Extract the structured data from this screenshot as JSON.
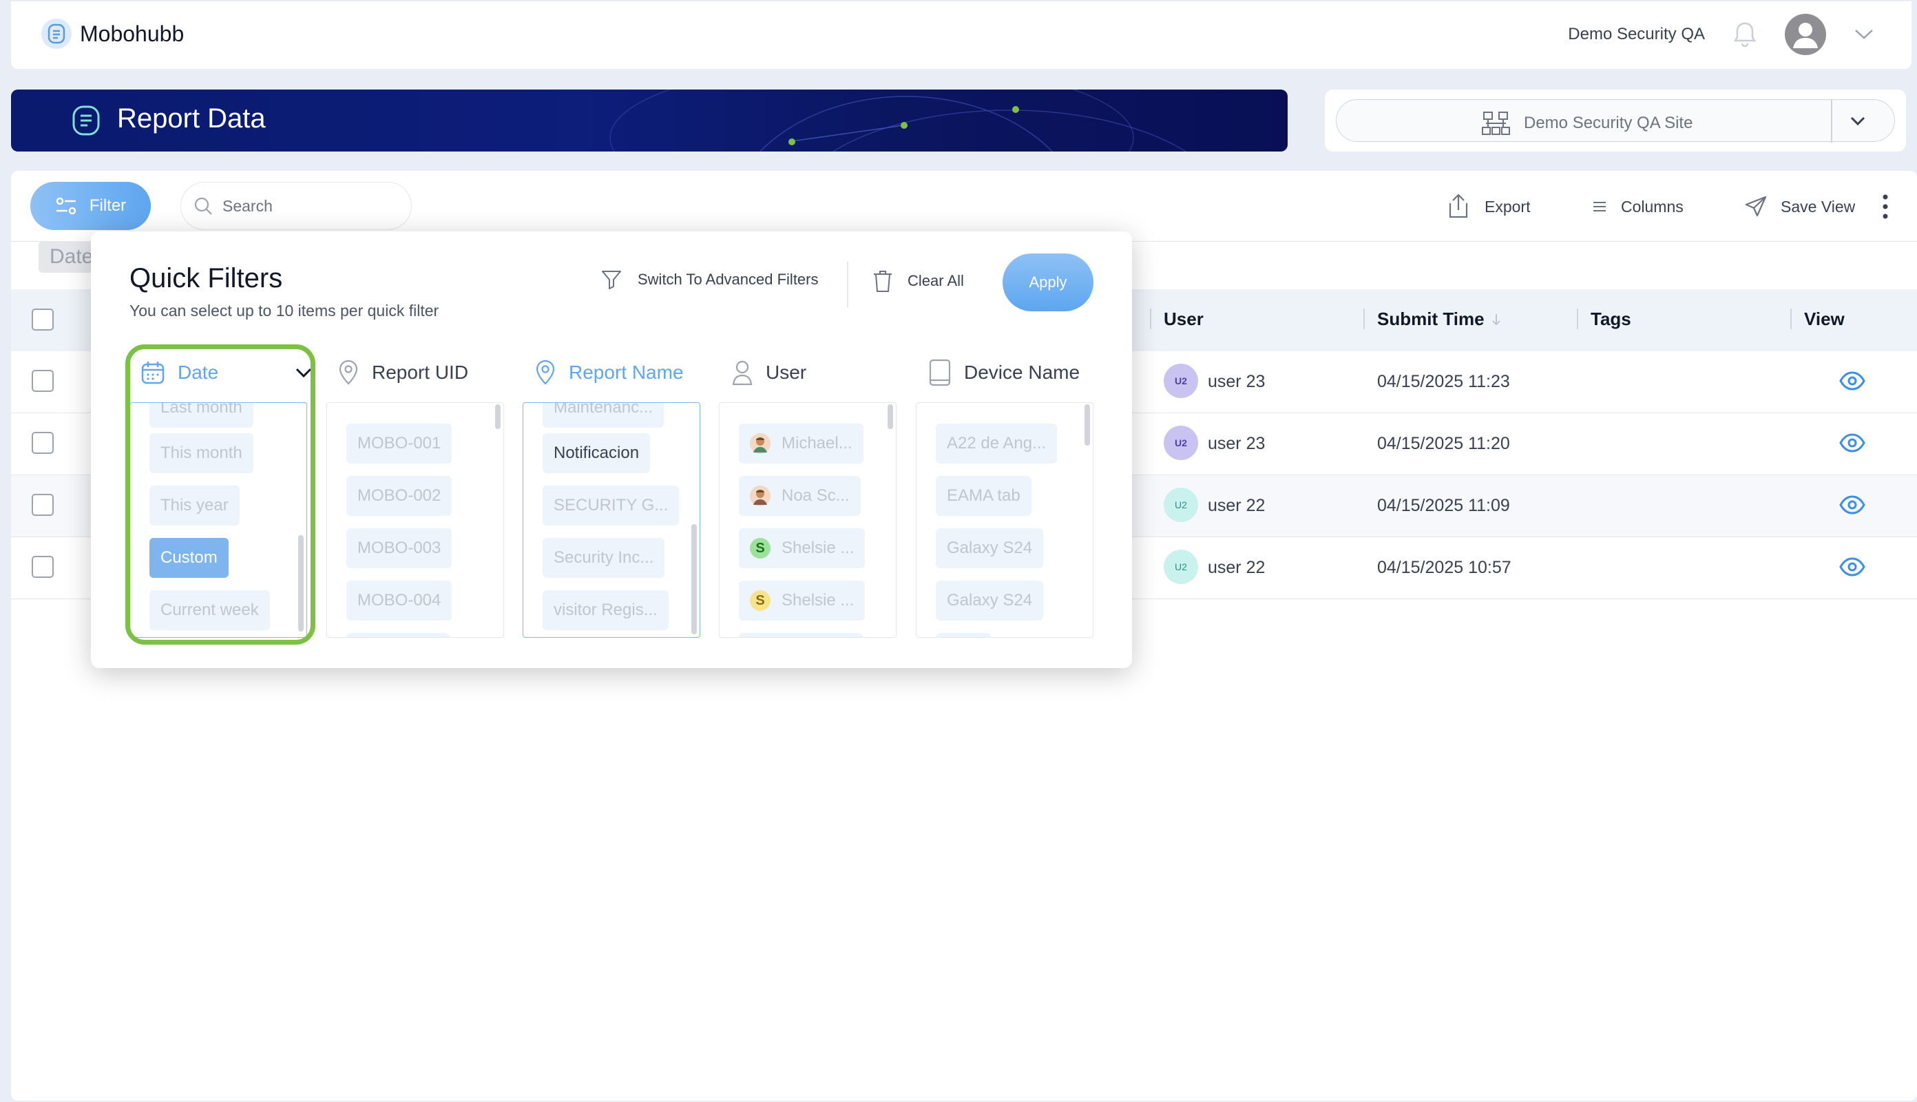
{
  "app": {
    "name": "Mobohubb"
  },
  "topbar": {
    "user_name": "Demo Security QA"
  },
  "banner": {
    "title": "Report Data"
  },
  "site_select": {
    "value": "Demo Security QA Site"
  },
  "toolbar": {
    "filter_label": "Filter",
    "search_placeholder": "Search",
    "export_label": "Export",
    "columns_label": "Columns",
    "save_view_label": "Save View"
  },
  "active_filter_chip": "Date",
  "table": {
    "headers": {
      "user": "User",
      "submit_time": "Submit Time",
      "tags": "Tags",
      "view": "View"
    },
    "rows": [
      {
        "user_initials": "U2",
        "user": "user 23",
        "submit_time": "04/15/2025 11:23"
      },
      {
        "user_initials": "U2",
        "user": "user 23",
        "submit_time": "04/15/2025 11:20"
      },
      {
        "user_initials": "U2",
        "user": "user 22",
        "submit_time": "04/15/2025 11:09"
      },
      {
        "user_initials": "U2",
        "user": "user 22",
        "submit_time": "04/15/2025 10:57"
      }
    ]
  },
  "quick_filters": {
    "title": "Quick Filters",
    "subtitle": "You can select up to 10 items per quick filter",
    "advanced_label": "Switch To Advanced Filters",
    "clear_label": "Clear All",
    "apply_label": "Apply",
    "columns": {
      "date": {
        "label": "Date",
        "items": [
          "Last month",
          "This month",
          "This year",
          "Custom",
          "Current week"
        ],
        "selected": "Custom"
      },
      "report_uid": {
        "label": "Report UID",
        "items": [
          "MOBO-001",
          "MOBO-002",
          "MOBO-003",
          "MOBO-004"
        ]
      },
      "report_name": {
        "label": "Report Name",
        "items": [
          "Maintenanc...",
          "Notificacion",
          "SECURITY G...",
          "Security Inc...",
          "visitor Regis..."
        ]
      },
      "user": {
        "label": "User",
        "items": [
          "Michael...",
          "Noa Sc...",
          "Shelsie ...",
          "Shelsie ..."
        ],
        "initials": [
          "",
          "",
          "S",
          "S"
        ]
      },
      "device_name": {
        "label": "Device Name",
        "items": [
          "A22 de Ang...",
          "EAMA tab",
          "Galaxy S24",
          "Galaxy S24"
        ]
      }
    }
  },
  "colors": {
    "accent": "#5ea6f0",
    "banner": "#0a1a6e",
    "highlight": "#7cc142"
  }
}
